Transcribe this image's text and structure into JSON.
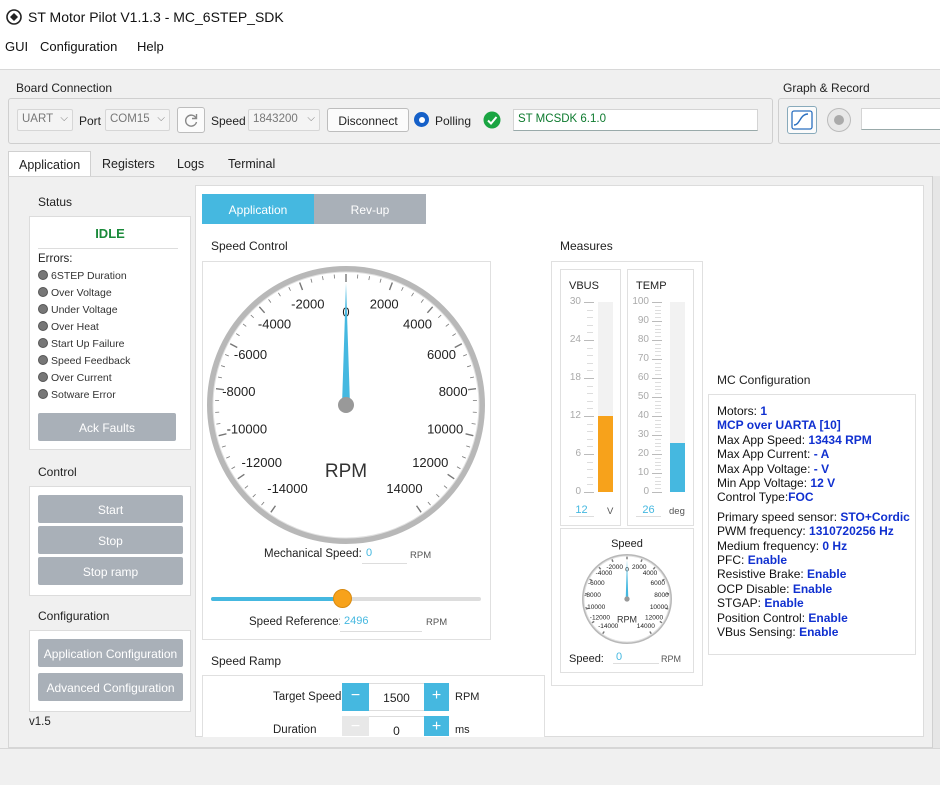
{
  "window": {
    "title": "ST Motor Pilot V1.1.3 - MC_6STEP_SDK"
  },
  "menu": [
    "GUI",
    "Configuration",
    "Help"
  ],
  "board": {
    "group": "Board Connection",
    "iface": "UART",
    "port_label": "Port",
    "port": "COM15",
    "speed_label": "Speed",
    "speed": "1843200",
    "disconnect": "Disconnect",
    "polling": "Polling",
    "sdk": "ST MCSDK 6.1.0"
  },
  "graph": {
    "group": "Graph & Record"
  },
  "tabs": [
    "Application",
    "Registers",
    "Logs",
    "Terminal"
  ],
  "status": {
    "title": "Status",
    "state": "IDLE",
    "errors_label": "Errors:",
    "errors": [
      "6STEP Duration",
      "Over Voltage",
      "Under Voltage",
      "Over Heat",
      "Start Up Failure",
      "Speed Feedback",
      "Over Current",
      "Sotware Error"
    ],
    "ack": "Ack Faults"
  },
  "control": {
    "title": "Control",
    "start": "Start",
    "stop": "Stop",
    "stop_ramp": "Stop ramp"
  },
  "configuration": {
    "title": "Configuration",
    "app": "Application Configuration",
    "adv": "Advanced Configuration"
  },
  "version": "v1.5",
  "subtabs": [
    "Application",
    "Rev-up"
  ],
  "speed_control": {
    "title": "Speed Control",
    "gauge_unit": "RPM",
    "ticks_left": [
      "0",
      "-2000",
      "-4000",
      "-6000",
      "-8000",
      "-10000",
      "-12000",
      "-14000"
    ],
    "ticks_right": [
      "2000",
      "4000",
      "6000",
      "8000",
      "10000",
      "12000",
      "14000"
    ],
    "mech_label": "Mechanical Speed:",
    "mech_value": "0",
    "mech_unit": "RPM",
    "ref_label": "Speed Reference:",
    "ref_value": "2496",
    "ref_unit": "RPM",
    "slider_fraction": 0.49
  },
  "speed_ramp": {
    "title": "Speed Ramp",
    "target_label": "Target Speed",
    "target_value": "1500",
    "target_unit": "RPM",
    "duration_label": "Duration",
    "duration_value": "0",
    "duration_unit": "ms",
    "minus": "−",
    "plus": "+"
  },
  "measures": {
    "title": "Measures",
    "vbus": {
      "label": "VBUS",
      "ticks": [
        "30",
        "24",
        "18",
        "12",
        "6",
        "0"
      ],
      "value": "12",
      "unit": "V",
      "level": 0.4,
      "color": "#f7a21b"
    },
    "temp": {
      "label": "TEMP",
      "ticks": [
        "100",
        "90",
        "80",
        "70",
        "60",
        "50",
        "40",
        "30",
        "20",
        "10",
        "0"
      ],
      "value": "26",
      "unit": "deg",
      "level": 0.26,
      "color": "#45b8e0"
    },
    "speed": {
      "label": "Speed",
      "unit": "RPM",
      "value_label": "Speed:",
      "value": "0",
      "value_unit": "RPM"
    }
  },
  "mc_config": {
    "title": "MC Configuration",
    "rows": [
      {
        "k": "Motors:",
        "v": "1"
      },
      {
        "k": "",
        "v": "MCP over UARTA [10]"
      },
      {
        "k": "Max App Speed:",
        "v": "13434 RPM"
      },
      {
        "k": "Max App Current:",
        "v": "- A"
      },
      {
        "k": "Max App Voltage:",
        "v": "- V"
      },
      {
        "k": "Min App Voltage:",
        "v": "12 V"
      },
      {
        "k": "Control Type:",
        "v": "FOC"
      },
      {
        "k": "Primary speed sensor:",
        "v": "STO+Cordic"
      },
      {
        "k": "PWM frequency:",
        "v": "1310720256 Hz"
      },
      {
        "k": "Medium frequency:",
        "v": "0 Hz"
      },
      {
        "k": "PFC:",
        "v": "Enable"
      },
      {
        "k": "Resistive Brake:",
        "v": "Enable"
      },
      {
        "k": "OCP Disable:",
        "v": "Enable"
      },
      {
        "k": "STGAP:",
        "v": "Enable"
      },
      {
        "k": "Position Control:",
        "v": "Enable"
      },
      {
        "k": "VBus Sensing:",
        "v": "Enable"
      }
    ]
  }
}
